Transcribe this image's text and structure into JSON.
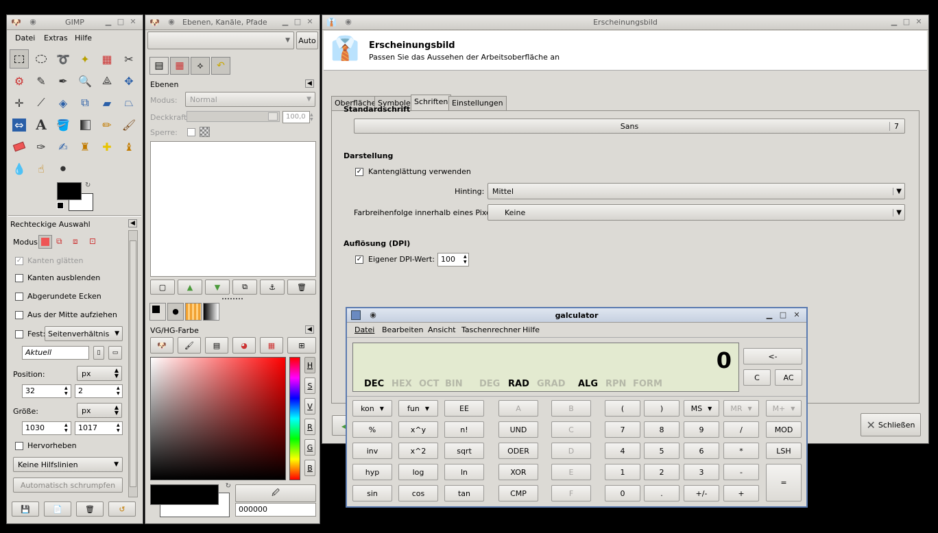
{
  "gimp": {
    "title": "GIMP",
    "menu": [
      "Datei",
      "Extras",
      "Hilfe"
    ],
    "tool_options_title": "Rechteckige Auswahl",
    "mode_label": "Modus:",
    "antialias": "Kanten glätten",
    "feather": "Kanten ausblenden",
    "rounded": "Abgerundete Ecken",
    "center": "Aus der Mitte aufziehen",
    "fixed_label": "Fest:",
    "fixed_value": "Seitenverhältnis",
    "current": "Aktuell",
    "position_label": "Position:",
    "position_unit": "px",
    "pos_x": "32",
    "pos_y": "2",
    "size_label": "Größe:",
    "size_unit": "px",
    "size_w": "1030",
    "size_h": "1017",
    "highlight": "Hervorheben",
    "guides": "Keine Hilfslinien",
    "autoshrink": "Automatisch schrumpfen"
  },
  "layers": {
    "title": "Ebenen, Kanäle, Pfade",
    "auto": "Auto",
    "section": "Ebenen",
    "mode_label": "Modus:",
    "mode_value": "Normal",
    "opacity_label": "Deckkraft:",
    "opacity_value": "100,0",
    "lock_label": "Sperre:",
    "color_section": "VG/HG-Farbe",
    "hex_value": "000000",
    "channel_tabs": [
      "H",
      "S",
      "V",
      "R",
      "G",
      "B"
    ]
  },
  "appearance": {
    "title": "Erscheinungsbild",
    "header_title": "Erscheinungsbild",
    "header_subtitle": "Passen Sie das Aussehen der Arbeitsoberfläche an",
    "tabs": [
      "Oberfläche",
      "Symbole",
      "Schriften",
      "Einstellungen"
    ],
    "default_font_heading": "Standardschrift",
    "font_name": "Sans",
    "font_size": "7",
    "rendering_heading": "Darstellung",
    "antialiasing": "Kantenglättung verwenden",
    "hinting_label": "Hinting:",
    "hinting_value": "Mittel",
    "subpixel_label": "Farbreihenfolge innerhalb eines Pixels:",
    "subpixel_value": "Keine",
    "dpi_heading": "Auflösung (DPI)",
    "dpi_label": "Eigener DPI-Wert:",
    "dpi_value": "100",
    "close_label": "Schließen"
  },
  "calc": {
    "title": "galculator",
    "menu": [
      "Datei",
      "Bearbeiten",
      "Ansicht",
      "Taschenrechner",
      "Hilfe"
    ],
    "display_value": "0",
    "modes": [
      "DEC",
      "HEX",
      "OCT",
      "BIN",
      "DEG",
      "RAD",
      "GRAD",
      "ALG",
      "RPN",
      "FORM"
    ],
    "backspace": "<-",
    "clear": "C",
    "allclear": "AC",
    "rows": [
      [
        "kon",
        "fun",
        "EE",
        "A",
        "B",
        "(",
        ")",
        "MS",
        "MR",
        "M+"
      ],
      [
        "%",
        "x^y",
        "n!",
        "UND",
        "C",
        "7",
        "8",
        "9",
        "/",
        "MOD"
      ],
      [
        "inv",
        "x^2",
        "sqrt",
        "ODER",
        "D",
        "4",
        "5",
        "6",
        "*",
        "LSH"
      ],
      [
        "hyp",
        "log",
        "ln",
        "XOR",
        "E",
        "1",
        "2",
        "3",
        "-",
        "="
      ],
      [
        "sin",
        "cos",
        "tan",
        "CMP",
        "F",
        "0",
        ".",
        "+/-",
        "+",
        ""
      ]
    ]
  }
}
